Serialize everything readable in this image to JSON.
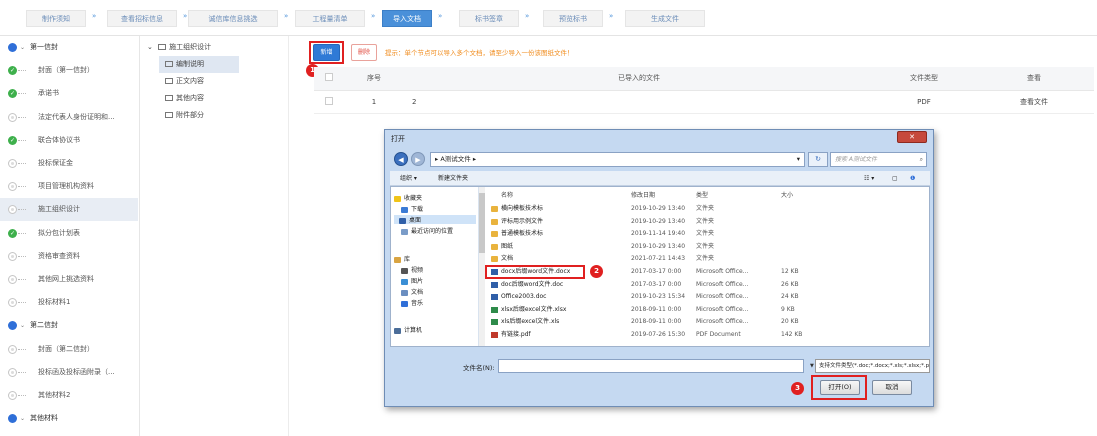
{
  "steps": [
    {
      "label": "制作须知",
      "active": false
    },
    {
      "label": "查看招标信息",
      "active": false
    },
    {
      "label": "诚信库信息挑选",
      "active": false
    },
    {
      "label": "工程量清单",
      "active": false
    },
    {
      "label": "导入文档",
      "active": true
    },
    {
      "label": "标书签章",
      "active": false
    },
    {
      "label": "预览标书",
      "active": false
    },
    {
      "label": "生成文件",
      "active": false
    }
  ],
  "step_arrow": "»",
  "left_tree": [
    {
      "label": "第一信封",
      "kind": "group",
      "caret": "⌄"
    },
    {
      "label": "封面（第一信封）",
      "kind": "done"
    },
    {
      "label": "承诺书",
      "kind": "done"
    },
    {
      "label": "法定代表人身份证明和...",
      "kind": "pend"
    },
    {
      "label": "联合体协议书",
      "kind": "done"
    },
    {
      "label": "投标保证金",
      "kind": "pend"
    },
    {
      "label": "项目管理机构资料",
      "kind": "pend"
    },
    {
      "label": "施工组织设计",
      "kind": "pend",
      "selected": true
    },
    {
      "label": "拟分包计划表",
      "kind": "done"
    },
    {
      "label": "资格审查资料",
      "kind": "pend"
    },
    {
      "label": "其他网上挑选资料",
      "kind": "pend"
    },
    {
      "label": "投标材料1",
      "kind": "pend"
    },
    {
      "label": "第二信封",
      "kind": "group",
      "caret": "⌄"
    },
    {
      "label": "封面（第二信封）",
      "kind": "pend"
    },
    {
      "label": "投标函及投标函附录（...",
      "kind": "pend"
    },
    {
      "label": "其他材料2",
      "kind": "pend"
    },
    {
      "label": "其他材料",
      "kind": "group",
      "caret": "⌄"
    }
  ],
  "sub_tree": {
    "root": "施工组织设计",
    "root_caret": "⌄",
    "items": [
      {
        "label": "编制说明",
        "selected": true
      },
      {
        "label": "正文内容",
        "selected": false
      },
      {
        "label": "其他内容",
        "selected": false
      },
      {
        "label": "附件部分",
        "selected": false
      }
    ]
  },
  "toolbar": {
    "new": "新增",
    "delete": "删除",
    "tip": "提示：单个节点可以导入多个文档，请至少导入一份该图纸文件！"
  },
  "table": {
    "headers": [
      "序号",
      "已导入的文件",
      "文件类型",
      "查看"
    ],
    "rows": [
      {
        "index": "1",
        "file": "2",
        "type": "PDF",
        "action": "查看文件"
      }
    ]
  },
  "markers": {
    "m1": "1",
    "m2": "2",
    "m3": "3"
  },
  "dialog": {
    "title": "打开",
    "close": "✕",
    "back": "◀",
    "forward": "▶",
    "path": "▸ A测试文件 ▸",
    "path_arrow": "▾",
    "refresh": "↻",
    "search_placeholder": "搜索 A测试文件",
    "search_icon": "⌕",
    "toolbar": {
      "organize": "组织 ▾",
      "new_folder": "新建文件夹",
      "view": "☷ ▾",
      "pane": "▢",
      "help": "❶"
    },
    "nav": [
      {
        "label": "收藏夹",
        "color": "#f0c419"
      },
      {
        "label": "下载",
        "color": "#3a7bd5"
      },
      {
        "label": "桌面",
        "color": "#2f5fa8",
        "selected": true
      },
      {
        "label": "最近访问的位置",
        "color": "#7a9cc8"
      },
      {
        "label": "库",
        "color": "#d9a441"
      },
      {
        "label": "视频",
        "color": "#555"
      },
      {
        "label": "图片",
        "color": "#3a8fd5"
      },
      {
        "label": "文档",
        "color": "#6b8ec0"
      },
      {
        "label": "音乐",
        "color": "#2f6fd8"
      },
      {
        "label": "计算机",
        "color": "#4b6d99"
      }
    ],
    "columns": [
      "名称",
      "修改日期",
      "类型",
      "大小"
    ],
    "files": [
      {
        "name": "横向模板技术标",
        "date": "2019-10-29 13:40",
        "type": "文件夹",
        "size": "",
        "kind": "f"
      },
      {
        "name": "评标用示例文件",
        "date": "2019-10-29 13:40",
        "type": "文件夹",
        "size": "",
        "kind": "f"
      },
      {
        "name": "普通模板技术标",
        "date": "2019-11-14 19:40",
        "type": "文件夹",
        "size": "",
        "kind": "f"
      },
      {
        "name": "图纸",
        "date": "2019-10-29 13:40",
        "type": "文件夹",
        "size": "",
        "kind": "f"
      },
      {
        "name": "文档",
        "date": "2021-07-21 14:43",
        "type": "文件夹",
        "size": "",
        "kind": "f"
      },
      {
        "name": "docx后缀word文件.docx",
        "date": "2017-03-17 0:00",
        "type": "Microsoft Office...",
        "size": "12 KB",
        "kind": "w"
      },
      {
        "name": "doc后缀word文件.doc",
        "date": "2017-03-17 0:00",
        "type": "Microsoft Office...",
        "size": "26 KB",
        "kind": "w"
      },
      {
        "name": "Office2003.doc",
        "date": "2019-10-23 15:34",
        "type": "Microsoft Office...",
        "size": "24 KB",
        "kind": "w"
      },
      {
        "name": "xlsx后缀excel文件.xlsx",
        "date": "2018-09-11 0:00",
        "type": "Microsoft Office...",
        "size": "9 KB",
        "kind": "x"
      },
      {
        "name": "xls后缀excel文件.xls",
        "date": "2018-09-11 0:00",
        "type": "Microsoft Office...",
        "size": "20 KB",
        "kind": "x"
      },
      {
        "name": "有链接.pdf",
        "date": "2019-07-26 15:30",
        "type": "PDF Document",
        "size": "142 KB",
        "kind": "p"
      }
    ],
    "filename_label": "文件名(N):",
    "filename_value": "",
    "filetype": "支持文件类型(*.doc;*.docx;*.xls;*.xlsx;*.pdf;*.dwg;*.dwf;*.jpg;*.png;*.bmp)",
    "open": "打开(O)",
    "cancel": "取消"
  }
}
